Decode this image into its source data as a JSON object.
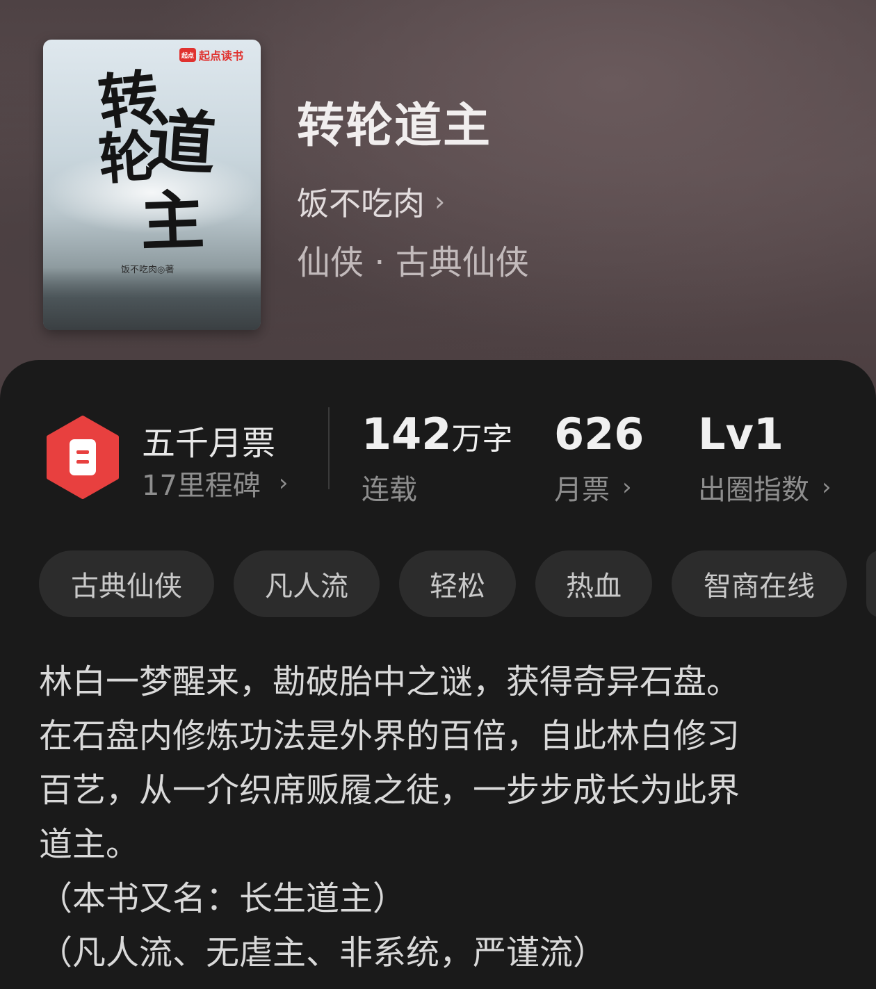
{
  "book": {
    "title": "转轮道主",
    "author": "饭不吃肉",
    "genre": "仙侠 · 古典仙侠",
    "cover": {
      "badge": "起点读书",
      "badge_logo": "起点",
      "calligraphy": [
        "转",
        "轮",
        "道",
        "主"
      ],
      "author_line": "饭不吃肉◎著"
    }
  },
  "stats": {
    "milestone_title": "五千月票",
    "milestone_sub": "17里程碑",
    "words_num": "142",
    "words_unit": "万字",
    "words_label": "连载",
    "monthly_votes": "626",
    "monthly_votes_label": "月票",
    "level": "Lv1",
    "level_label": "出圈指数"
  },
  "tags": [
    "古典仙侠",
    "凡人流",
    "轻松",
    "热血",
    "智商在线"
  ],
  "description": [
    "林白一梦醒来，勘破胎中之谜，获得奇异石盘。",
    "在石盘内修炼功法是外界的百倍，自此林白修习",
    "百艺，从一介织席贩履之徒，一步步成长为此界",
    "道主。",
    "（本书又名：长生道主）",
    "（凡人流、无虐主、非系统，严谨流）"
  ],
  "colors": {
    "accent": "#e8403f",
    "panel": "#1a1a1a",
    "tag_bg": "#2c2c2c"
  }
}
